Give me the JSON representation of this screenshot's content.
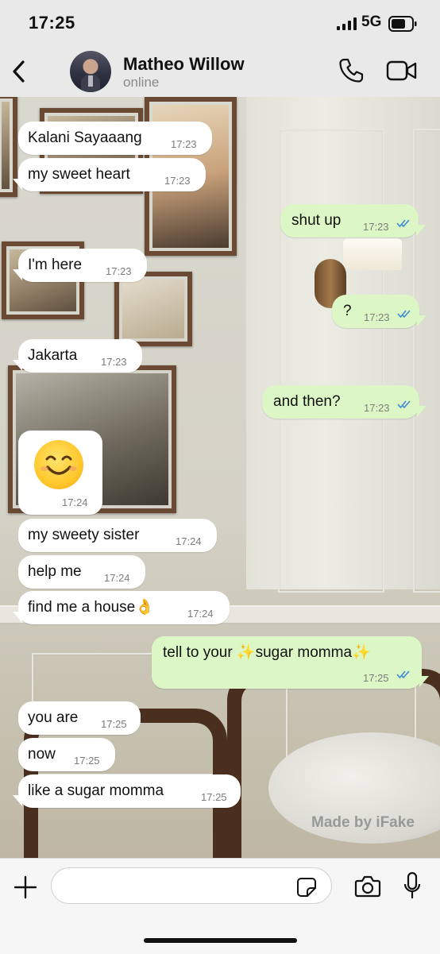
{
  "status_bar": {
    "time": "17:25",
    "network": "5G"
  },
  "header": {
    "contact_name": "Matheo Willow",
    "contact_status": "online"
  },
  "messages": [
    {
      "dir": "in",
      "text": "Kalani Sayaaang",
      "time": "17:23"
    },
    {
      "dir": "in",
      "text": "my sweet heart",
      "time": "17:23"
    },
    {
      "dir": "out",
      "text": "shut up",
      "time": "17:23",
      "read": true
    },
    {
      "dir": "in",
      "text": "I'm here",
      "time": "17:23"
    },
    {
      "dir": "out",
      "text": "?",
      "time": "17:23",
      "read": true
    },
    {
      "dir": "in",
      "text": "Jakarta",
      "time": "17:23"
    },
    {
      "dir": "out",
      "text": "and then?",
      "time": "17:23",
      "read": true
    },
    {
      "dir": "in",
      "text": "😊",
      "time": "17:24",
      "emoji_only": true
    },
    {
      "dir": "in",
      "text": "my sweety sister",
      "time": "17:24"
    },
    {
      "dir": "in",
      "text": "help me",
      "time": "17:24"
    },
    {
      "dir": "in",
      "text": "find me a house👌",
      "time": "17:24"
    },
    {
      "dir": "out",
      "text": "tell to your ✨sugar momma✨",
      "time": "17:25",
      "read": true
    },
    {
      "dir": "in",
      "text": "you are",
      "time": "17:25"
    },
    {
      "dir": "in",
      "text": "now",
      "time": "17:25"
    },
    {
      "dir": "in",
      "text": "like a sugar momma",
      "time": "17:25"
    }
  ],
  "watermark": "Made by iFake",
  "composer": {
    "value": ""
  },
  "colors": {
    "incoming": "#ffffff",
    "outgoing": "#dcf7c5",
    "read_ticks": "#3f8ad8"
  },
  "icons": [
    "back-icon",
    "phone-icon",
    "video-icon",
    "plus-icon",
    "sticker-icon",
    "camera-icon",
    "mic-icon"
  ]
}
